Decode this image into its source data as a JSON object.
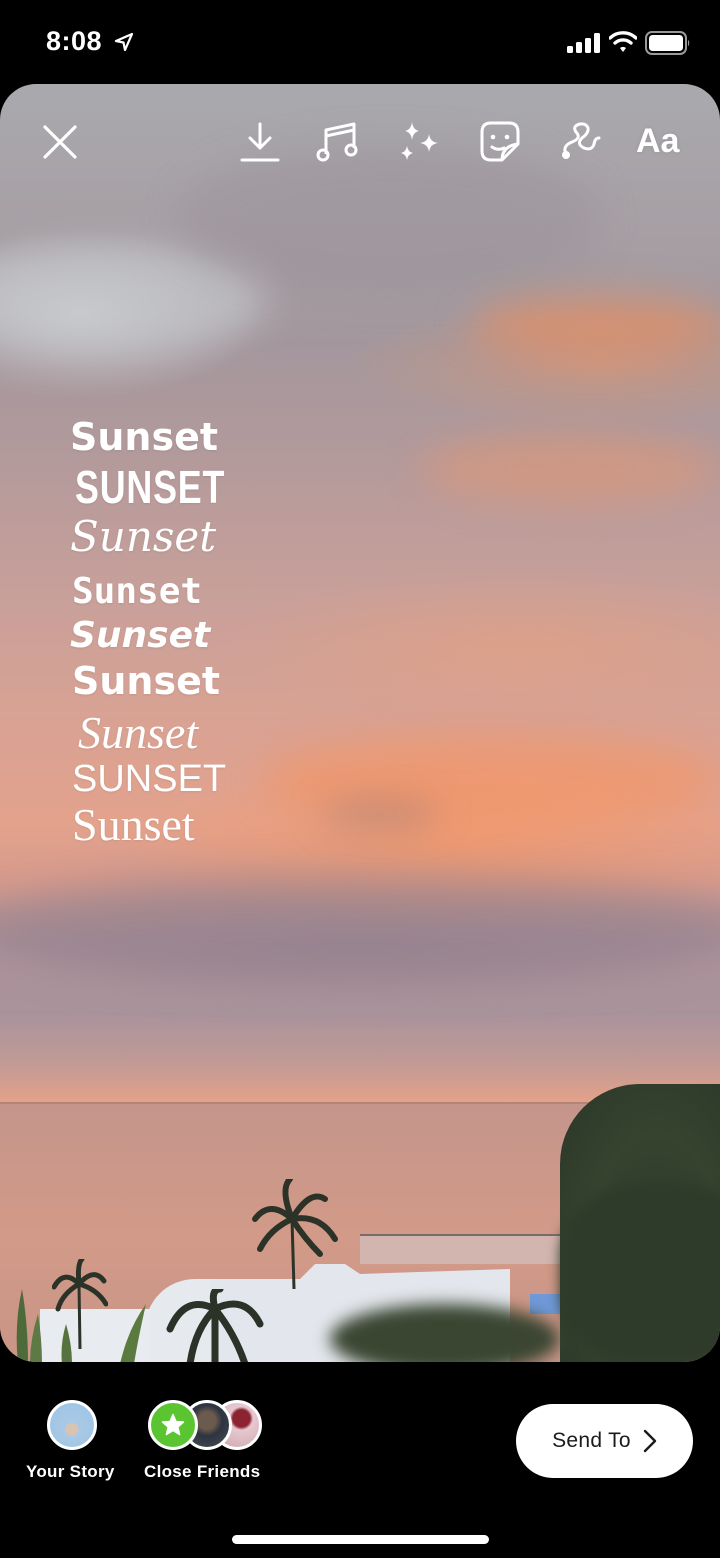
{
  "status_bar": {
    "time": "8:08",
    "icons": [
      "location-arrow-icon",
      "cellular-signal-icon",
      "wifi-icon",
      "battery-icon"
    ]
  },
  "toolbar": {
    "close_icon": "close-icon",
    "download_icon": "download-icon",
    "music_icon": "music-note-icon",
    "effects_icon": "sparkles-icon",
    "sticker_icon": "sticker-icon",
    "draw_icon": "draw-squiggle-icon",
    "text_label": "Aa"
  },
  "canvas": {
    "text_overlays": [
      {
        "text": "Sunset",
        "style": "bold-sans"
      },
      {
        "text": "SUNSET",
        "style": "condensed-caps"
      },
      {
        "text": "Sunset",
        "style": "script"
      },
      {
        "text": "Sunset",
        "style": "typewriter"
      },
      {
        "text": "Sunset",
        "style": "bold-italic"
      },
      {
        "text": "Sunset",
        "style": "rounded"
      },
      {
        "text": "Sunset",
        "style": "serif-italic"
      },
      {
        "text": "SUNSET",
        "style": "sans-caps"
      },
      {
        "text": "Sunset",
        "style": "serif"
      }
    ]
  },
  "bottom_bar": {
    "your_story": {
      "label": "Your Story"
    },
    "close_friends": {
      "label": "Close Friends",
      "badge_color": "#5ac530"
    },
    "send_button": {
      "label": "Send To"
    }
  }
}
